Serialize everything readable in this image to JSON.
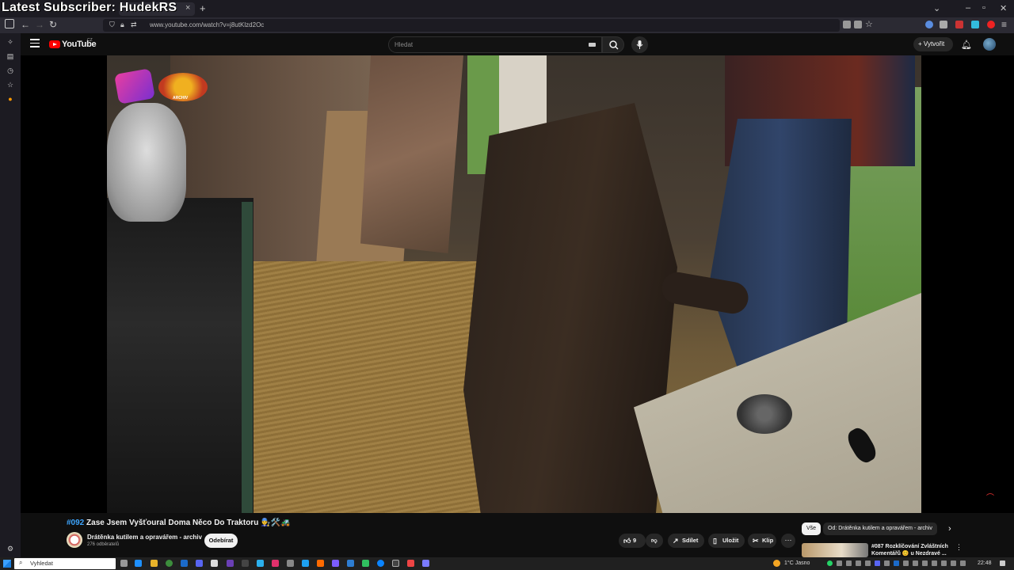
{
  "overlay": {
    "title": "Latest Subscriber: HudekRS"
  },
  "browser": {
    "url": "www.youtube.com/watch?v=j8utKlzd2Oc",
    "new_tab": "+",
    "tab_close": "×"
  },
  "youtube": {
    "logo_text": "YouTube",
    "region": "CZ",
    "search_placeholder": "Hledat",
    "create_label": "Vytvořit"
  },
  "video": {
    "title_tag": "#092",
    "title": "Zase Jsem Vyšťoural Doma Něco Do Traktoru 👨‍🔧🛠️🚜",
    "watermark_text": "ARCHIV",
    "channel_name": "Drátěnka kutilem a opravářem - archiv",
    "subscribers": "276 odběratelů",
    "subscribe_label": "Odebírat",
    "likes": "9",
    "share_label": "Sdílet",
    "save_label": "Uložit",
    "clip_label": "Klip"
  },
  "sidebar_chips": {
    "all": "Vše",
    "from_channel": "Od: Drátěnka kutilem a opravářem - archiv"
  },
  "recommendation": {
    "title": "#087 Rozklíčování Zvláštních Komentářů 😊 u Nezdravé ..."
  },
  "taskbar": {
    "search_placeholder": "Vyhledat",
    "weather": "1°C  Jasno",
    "time": "22:48"
  },
  "colors": {
    "accent": "#3ea6ff",
    "yt_red": "#ff0000",
    "background": "#0f0f0f"
  }
}
